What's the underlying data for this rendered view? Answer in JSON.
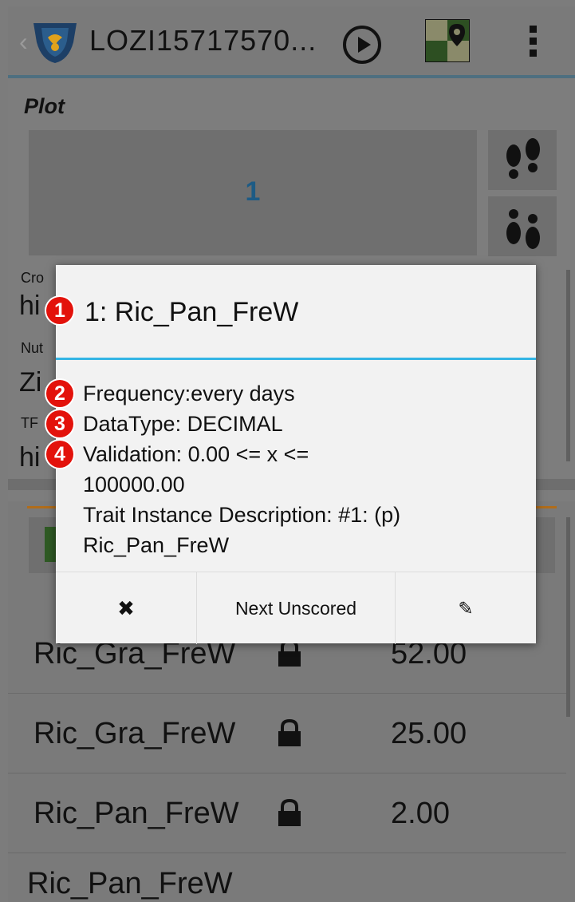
{
  "action_bar": {
    "title": "LOZI15717570..."
  },
  "plot": {
    "label": "Plot",
    "number": "1"
  },
  "background_fields": {
    "crop_label": "Cro",
    "crop_value": "hi",
    "nut_label": "Nut",
    "nut_value": "Zi",
    "tr_label": "TF",
    "tr_value": "hi"
  },
  "traits": [
    {
      "name": "Ric_Gra_FreW",
      "value": "52.00"
    },
    {
      "name": "Ric_Gra_FreW",
      "value": "25.00"
    },
    {
      "name": "Ric_Pan_FreW",
      "value": "2.00"
    },
    {
      "name": "Ric_Pan_FreW",
      "value": ""
    }
  ],
  "dialog": {
    "title": "1: Ric_Pan_FreW",
    "frequency": "Frequency:every days",
    "datatype": "DataType: DECIMAL",
    "validation": "Validation: 0.00 <= x <=\n100000.00",
    "description": "Trait Instance Description: #1: (p)\nRic_Pan_FreW",
    "close_label": "✖",
    "next_label": "Next Unscored",
    "edit_label": "✎"
  },
  "badges": [
    "1",
    "2",
    "3",
    "4"
  ],
  "colors": {
    "accent": "#33b5e5",
    "badge": "#e3120b",
    "plot_number": "#1d5b85"
  }
}
